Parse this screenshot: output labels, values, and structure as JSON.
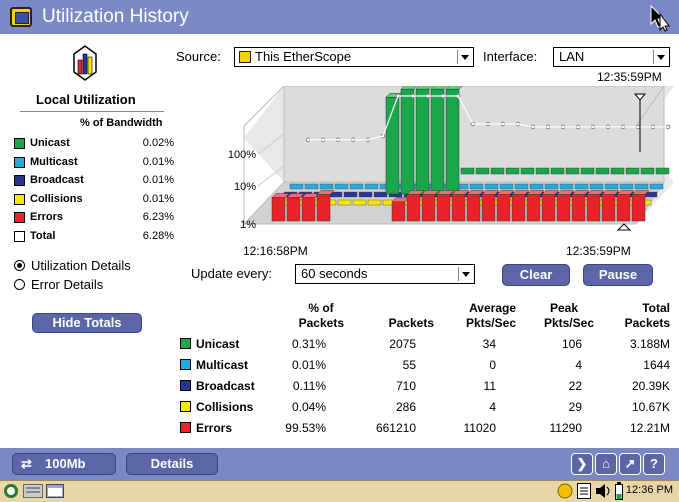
{
  "window": {
    "title": "Utilization History"
  },
  "toolbar": {
    "source_label": "Source:",
    "source_value": "This EtherScope",
    "interface_label": "Interface:",
    "interface_value": "LAN"
  },
  "local": {
    "title": "Local Utilization",
    "header": "% of Bandwidth",
    "items": [
      {
        "name": "Unicast",
        "value": "0.02%",
        "color": "#1aa64a"
      },
      {
        "name": "Multicast",
        "value": "0.01%",
        "color": "#29a8e0"
      },
      {
        "name": "Broadcast",
        "value": "0.01%",
        "color": "#2a3590"
      },
      {
        "name": "Collisions",
        "value": "0.01%",
        "color": "#f4e800"
      },
      {
        "name": "Errors",
        "value": "6.23%",
        "color": "#e8242a"
      },
      {
        "name": "Total",
        "value": "6.28%",
        "color": "#ffffff"
      }
    ]
  },
  "radios": {
    "details": "Utilization Details",
    "errors": "Error Details"
  },
  "chart": {
    "top_time": "12:35:59PM",
    "start_time": "12:16:58PM",
    "end_time": "12:35:59PM",
    "y_labels": [
      "100%",
      "10%",
      "1%"
    ]
  },
  "chart_data": {
    "type": "bar",
    "title": "",
    "y_scale": "log",
    "y_ticks": [
      "1%",
      "10%",
      "100%"
    ],
    "x_range": [
      "12:16:58PM",
      "12:35:59PM"
    ],
    "front_series": [
      {
        "name": "Errors",
        "values": [
          3,
          3,
          3,
          4,
          0,
          0,
          0,
          0,
          2,
          4,
          4,
          4,
          4,
          4,
          4,
          4,
          4,
          4,
          4,
          4,
          4,
          4,
          4,
          4,
          4
        ]
      },
      {
        "name": "Unicast",
        "values": [
          0,
          0,
          0,
          0,
          0,
          0,
          40,
          60,
          60,
          60,
          60,
          0,
          0,
          0,
          0,
          0,
          0,
          0,
          0,
          0,
          0,
          0,
          0,
          0,
          0
        ]
      }
    ],
    "total_line": [
      1.5,
      1.5,
      1.5,
      1.5,
      1.5,
      2,
      100,
      110,
      110,
      110,
      110,
      5,
      5,
      5,
      5,
      4,
      4,
      4,
      4,
      4,
      4,
      4,
      4,
      4,
      4
    ]
  },
  "controls": {
    "update_label": "Update every:",
    "update_value": "60 seconds",
    "clear": "Clear",
    "pause": "Pause",
    "hide_totals": "Hide Totals"
  },
  "table": {
    "headers": {
      "pct1": "% of",
      "pct2": "Packets",
      "packets": "Packets",
      "avg1": "Average",
      "avg2": "Pkts/Sec",
      "peak1": "Peak",
      "peak2": "Pkts/Sec",
      "total1": "Total",
      "total2": "Packets"
    },
    "rows": [
      {
        "name": "Unicast",
        "color": "#1aa64a",
        "pct": "0.31%",
        "packets": "2075",
        "avg": "34",
        "peak": "106",
        "total": "3.188M"
      },
      {
        "name": "Multicast",
        "color": "#29a8e0",
        "pct": "0.01%",
        "packets": "55",
        "avg": "0",
        "peak": "4",
        "total": "1644"
      },
      {
        "name": "Broadcast",
        "color": "#2a3590",
        "pct": "0.11%",
        "packets": "710",
        "avg": "11",
        "peak": "22",
        "total": "20.39K"
      },
      {
        "name": "Collisions",
        "color": "#f4e800",
        "pct": "0.04%",
        "packets": "286",
        "avg": "4",
        "peak": "29",
        "total": "10.67K"
      },
      {
        "name": "Errors",
        "color": "#e8242a",
        "pct": "99.53%",
        "packets": "661210",
        "avg": "11020",
        "peak": "11290",
        "total": "12.21M"
      }
    ]
  },
  "bottom": {
    "speed": "100Mb",
    "details": "Details"
  },
  "taskbar": {
    "clock": "12:36 PM"
  }
}
